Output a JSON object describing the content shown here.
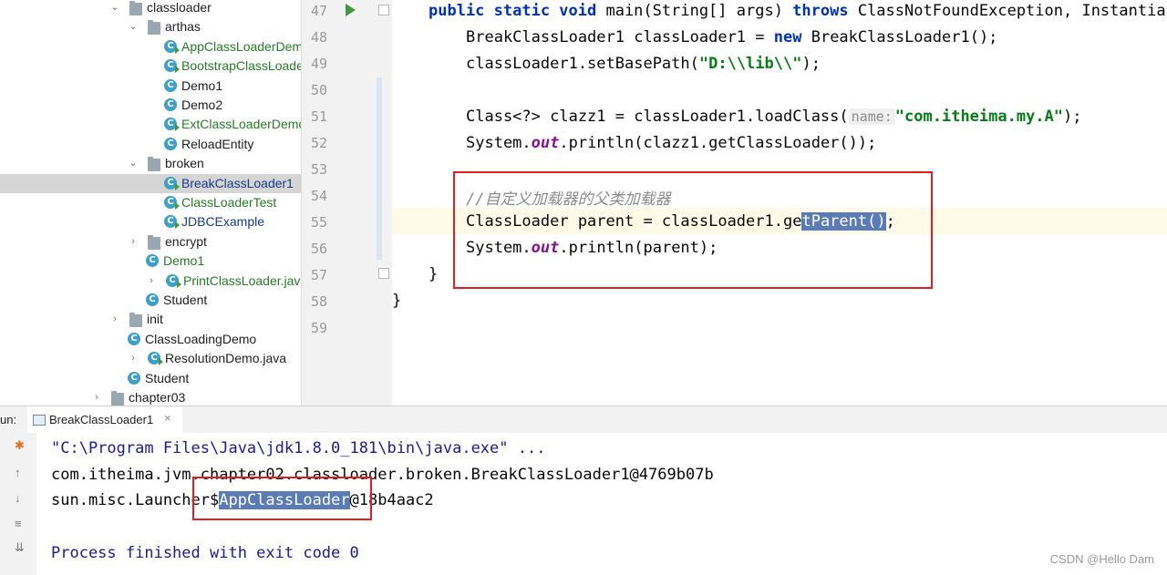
{
  "tree": [
    {
      "label": "classloader",
      "type": "folder",
      "arrow": "⌄",
      "indent": 120
    },
    {
      "label": "arthas",
      "type": "folder",
      "arrow": "⌄",
      "indent": 140
    },
    {
      "label": "AppClassLoaderDem",
      "type": "class-run",
      "color": "green",
      "indent": 180
    },
    {
      "label": "BootstrapClassLoade",
      "type": "class-run",
      "color": "green",
      "indent": 180
    },
    {
      "label": "Demo1",
      "type": "class",
      "color": "normal",
      "indent": 180
    },
    {
      "label": "Demo2",
      "type": "class",
      "color": "normal",
      "indent": 180
    },
    {
      "label": "ExtClassLoaderDemo",
      "type": "class-run",
      "color": "green",
      "indent": 180
    },
    {
      "label": "ReloadEntity",
      "type": "class",
      "color": "normal",
      "indent": 180
    },
    {
      "label": "broken",
      "type": "folder",
      "arrow": "⌄",
      "indent": 140
    },
    {
      "label": "BreakClassLoader1",
      "type": "class-run",
      "color": "blue",
      "indent": 180,
      "selected": true
    },
    {
      "label": "ClassLoaderTest",
      "type": "class-run",
      "color": "green",
      "indent": 180
    },
    {
      "label": "JDBCExample",
      "type": "class-run",
      "color": "blue",
      "indent": 180
    },
    {
      "label": "encrypt",
      "type": "folder",
      "arrow": "›",
      "indent": 140
    },
    {
      "label": "Demo1",
      "type": "class",
      "color": "green",
      "indent": 160
    },
    {
      "label": "PrintClassLoader.java",
      "type": "class-run",
      "color": "green",
      "indent": 160,
      "arrow": "›"
    },
    {
      "label": "Student",
      "type": "class",
      "color": "normal",
      "indent": 160
    },
    {
      "label": "init",
      "type": "folder",
      "arrow": "›",
      "indent": 120
    },
    {
      "label": "ClassLoadingDemo",
      "type": "class",
      "color": "normal",
      "indent": 140
    },
    {
      "label": "ResolutionDemo.java",
      "type": "class-run",
      "color": "normal",
      "indent": 140,
      "arrow": "›"
    },
    {
      "label": "Student",
      "type": "class",
      "color": "normal",
      "indent": 140
    },
    {
      "label": "chapter03",
      "type": "folder",
      "arrow": "›",
      "indent": 100
    }
  ],
  "line_numbers": [
    "47",
    "48",
    "49",
    "50",
    "51",
    "52",
    "53",
    "54",
    "55",
    "56",
    "57",
    "58",
    "59"
  ],
  "code": {
    "l47_kw": "public static void ",
    "l47_rest": "main(String[] args) ",
    "l47_throws": "throws ",
    "l47_exc": "ClassNotFoundException, Instantia",
    "l48_a": "BreakClassLoader1 classLoader1 = ",
    "l48_new": "new ",
    "l48_b": "BreakClassLoader1();",
    "l49_a": "classLoader1.setBasePath(",
    "l49_str": "\"D:\\\\lib\\\\\"",
    "l49_b": ");",
    "l51_a": "Class<?> clazz1 = classLoader1.loadClass(",
    "l51_hint": "name:",
    "l51_str": "\"com.itheima.my.A\"",
    "l51_b": ");",
    "l52_a": "System.",
    "l52_out": "out",
    "l52_b": ".println(clazz1.getClassLoader());",
    "l54_comment": "//自定义加载器的父类加载器",
    "l55_a": "ClassLoader parent = classLoader1.ge",
    "l55_hl": "tParent()",
    "l55_b": ";",
    "l56_a": "System.",
    "l56_out": "out",
    "l56_b": ".println(parent);",
    "l57": "}",
    "l58": "}"
  },
  "run": {
    "label": "un:",
    "tab": "BreakClassLoader1",
    "close": "×"
  },
  "console": {
    "cmd": "\"C:\\Program Files\\Java\\jdk1.8.0_181\\bin\\java.exe\" ...",
    "line1": "com.itheima.jvm.chapter02.classloader.broken.BreakClassLoader1@4769b07b",
    "line2_a": "sun.misc.Launcher$",
    "line2_hl": "AppClassLoader",
    "line2_b": "@18b4aac2",
    "done": "Process finished with exit code 0"
  },
  "toolbar_icons": [
    "rerun-icon",
    "up-arrow-icon",
    "down-arrow-icon",
    "soft-wrap-icon",
    "scroll-to-end-icon"
  ],
  "watermark": "CSDN @Hello Dam"
}
